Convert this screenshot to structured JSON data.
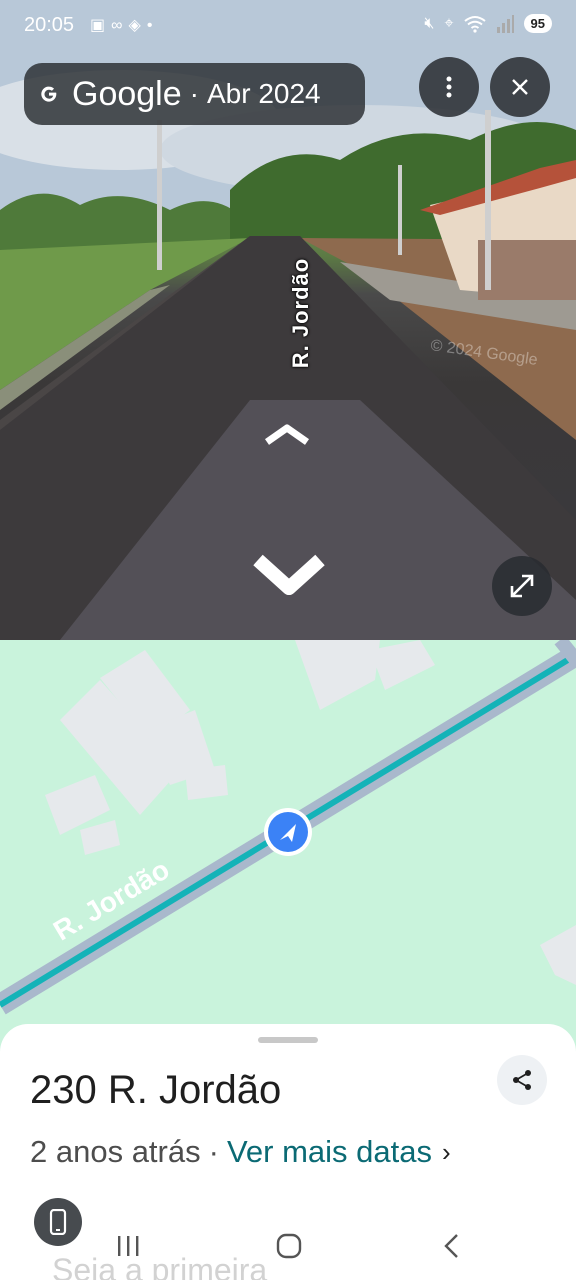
{
  "status_bar": {
    "time": "20:05",
    "battery": "95",
    "left_icons": [
      "screenshot-icon",
      "voicemail-icon",
      "shield-icon",
      "dot-icon"
    ],
    "right_icons": [
      "mute-icon",
      "location-icon",
      "wifi-icon",
      "signal-icon"
    ]
  },
  "streetview": {
    "brand": "Google",
    "separator": "·",
    "date": "Abr 2024",
    "street_label": "R. Jordão",
    "watermark": "© 2024 Google",
    "buttons": [
      "more-vert-icon",
      "close-icon",
      "fullscreen-icon"
    ]
  },
  "map": {
    "road_label": "R. Jordão",
    "colors": {
      "land": "#c9f3dc",
      "road": "#a9b8cc",
      "route": "#14b3b8",
      "building": "#e6e9ec",
      "marker": "#3b82f6"
    }
  },
  "sheet": {
    "address": "230 R. Jordão",
    "age": "2 anos atrás",
    "dot": "·",
    "more_dates": "Ver mais datas",
    "chevron": "›",
    "ghost_text": "Seja a primeira"
  },
  "nav": {
    "recent": "recent-apps-icon",
    "home": "home-icon",
    "back": "back-icon"
  }
}
